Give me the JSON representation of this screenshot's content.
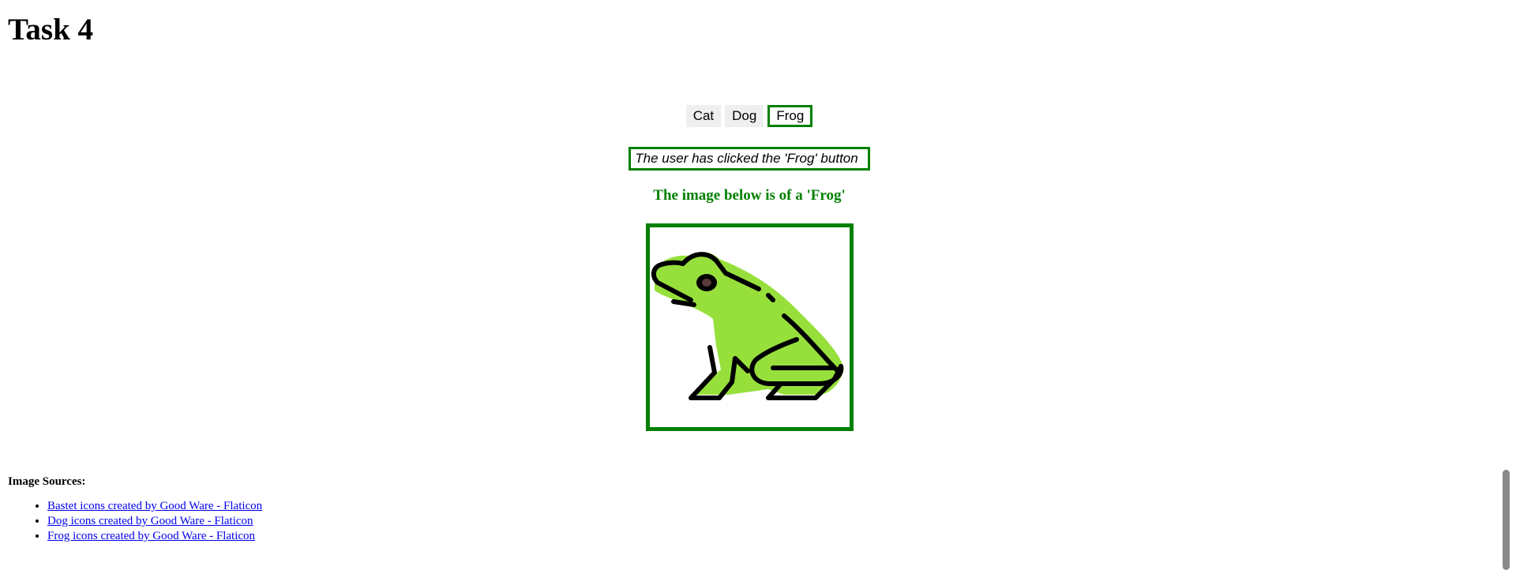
{
  "page": {
    "title": "Task 4"
  },
  "buttons": [
    {
      "label": "Cat",
      "selected": false
    },
    {
      "label": "Dog",
      "selected": false
    },
    {
      "label": "Frog",
      "selected": true
    }
  ],
  "status": {
    "text": "The user has clicked the 'Frog' button"
  },
  "caption": {
    "text": "The image below is of a 'Frog'"
  },
  "image": {
    "icon": "frog-icon",
    "body_color": "#97e03c",
    "outline_color": "#000000"
  },
  "sources": {
    "title": "Image Sources:",
    "links": [
      "Bastet icons created by Good Ware - Flaticon",
      "Dog icons created by Good Ware - Flaticon",
      "Frog icons created by Good Ware - Flaticon"
    ]
  },
  "colors": {
    "accent": "#008000",
    "link": "#0000ee",
    "button_bg": "#efefef"
  }
}
